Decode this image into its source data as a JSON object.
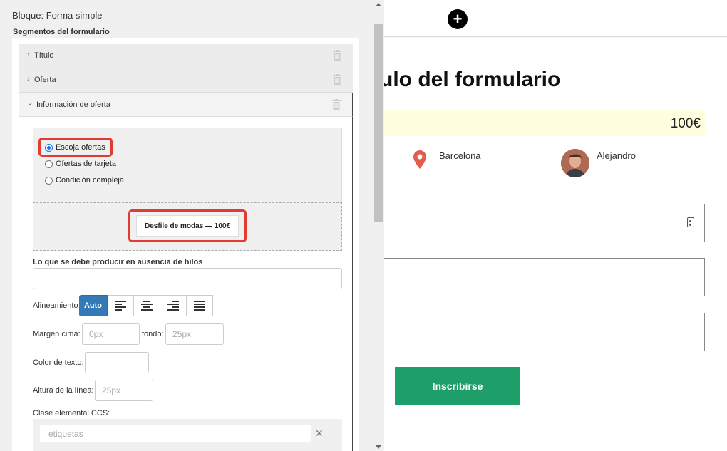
{
  "editor": {
    "title": "Bloque: Forma simple",
    "segments_title": "Segmentos del formulario",
    "segments": [
      {
        "label": "Título",
        "expanded": false
      },
      {
        "label": "Oferta",
        "expanded": false
      },
      {
        "label": "Información de oferta",
        "expanded": true
      }
    ],
    "offer_options": [
      {
        "label": "Escoja ofertas",
        "selected": true
      },
      {
        "label": "Ofertas de tarjeta",
        "selected": false
      },
      {
        "label": "Condición compleja",
        "selected": false
      }
    ],
    "selected_offer": "Desfile de modas — 100€",
    "no_threads_label": "Lo que se debe producir en ausencia de hilos",
    "no_threads_value": "",
    "alignment": {
      "label": "Alineamiento",
      "active": "Auto",
      "options": [
        "Auto",
        "align-left-icon",
        "align-center-icon",
        "align-right-icon",
        "align-justify-icon"
      ]
    },
    "margin": {
      "top_label": "Margen cima:",
      "top_placeholder": "0px",
      "bottom_label": "fondo:",
      "bottom_placeholder": "25px"
    },
    "text_color_label": "Color de texto:",
    "line_height": {
      "label": "Altura de la línea:",
      "placeholder": "25px"
    },
    "css_class": {
      "label": "Clase elemental CCS:",
      "placeholder": "etiquetas"
    },
    "highlight_color": "#e03c31",
    "accent_color": "#337ab7"
  },
  "preview": {
    "form_title": "ulo del formulario",
    "price": "100€",
    "city": "Barcelona",
    "person": "Alejandro",
    "submit_label": "Inscribirse",
    "submit_color": "#1e9e68",
    "price_bar_color": "#ffffe0"
  }
}
